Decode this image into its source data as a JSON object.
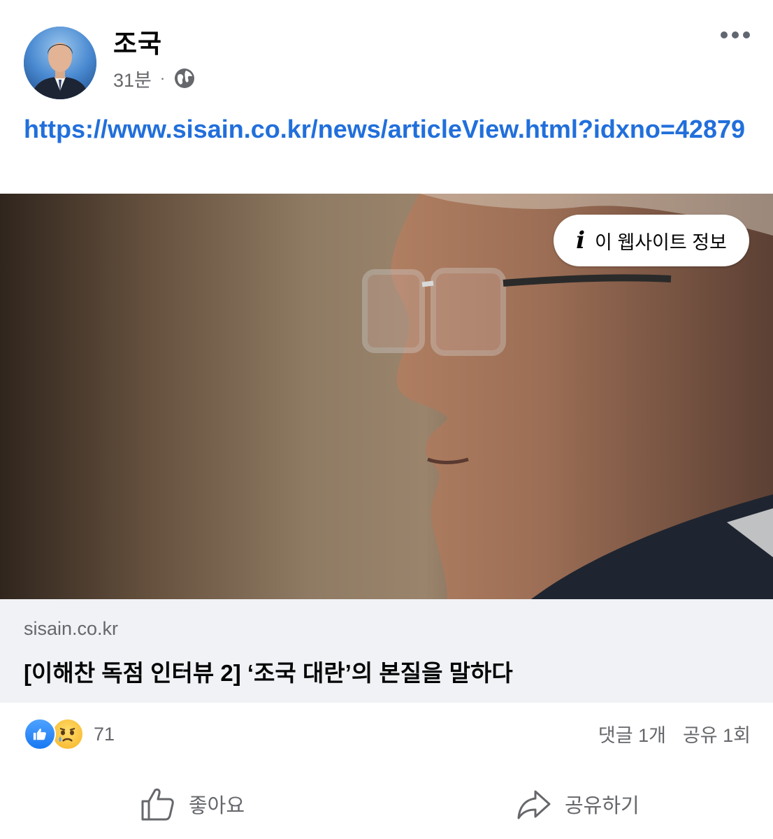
{
  "post": {
    "author": "조국",
    "time": "31분",
    "separator": "·",
    "privacy_icon": "globe-icon",
    "more_icon": "more-dots-icon",
    "link_text": "https://www.sisain.co.kr/news/articleView.html?idxno=42879"
  },
  "link_preview": {
    "info_label": "이 웹사이트 정보",
    "info_icon": "i",
    "domain": "sisain.co.kr",
    "title": "[이해찬 독점 인터뷰 2] ‘조국 대란’의 본질을 말하다"
  },
  "engagement": {
    "reaction_icons": [
      "like-icon",
      "sad-icon"
    ],
    "reaction_count": "71",
    "comments": "댓글 1개",
    "shares": "공유 1회"
  },
  "actions": {
    "like_label": "좋아요",
    "share_label": "공유하기"
  },
  "colors": {
    "link": "#216fdb",
    "secondary_text": "#65676b",
    "preview_bg": "#f0f2f5",
    "like_blue": "#1877f2"
  }
}
